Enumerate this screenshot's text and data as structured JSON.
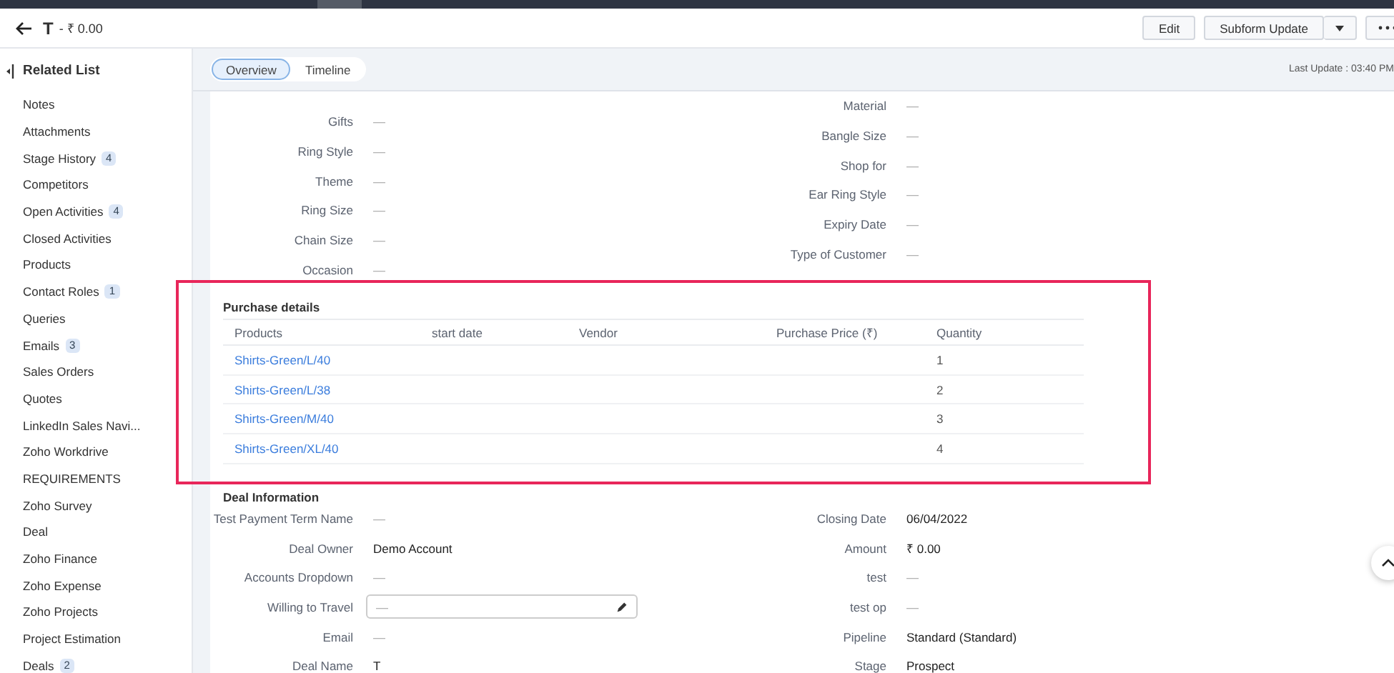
{
  "header": {
    "title": "T",
    "amount": "- ₹ 0.00",
    "buttons": [
      {
        "label": "Edit",
        "kind": "plain"
      },
      {
        "label": "Subform Update",
        "kind": "split"
      }
    ]
  },
  "tabs": [
    {
      "label": "Overview",
      "selected": true
    },
    {
      "label": "Timeline",
      "selected": false
    }
  ],
  "last_update": "Last Update : 03:40 PM",
  "sidebar": {
    "title": "Related List",
    "items": [
      {
        "label": "Notes"
      },
      {
        "label": "Attachments"
      },
      {
        "label": "Stage History",
        "count": "4"
      },
      {
        "label": "Competitors"
      },
      {
        "label": "Open Activities",
        "count": "4"
      },
      {
        "label": "Closed Activities"
      },
      {
        "label": "Products"
      },
      {
        "label": "Contact Roles",
        "count": "1"
      },
      {
        "label": "Queries"
      },
      {
        "label": "Emails",
        "count": "3"
      },
      {
        "label": "Sales Orders"
      },
      {
        "label": "Quotes"
      },
      {
        "label": "LinkedIn Sales Navi..."
      },
      {
        "label": "Zoho Workdrive"
      },
      {
        "label": "REQUIREMENTS"
      },
      {
        "label": "Zoho Survey"
      },
      {
        "label": "Deal"
      },
      {
        "label": "Zoho Finance"
      },
      {
        "label": "Zoho Expense"
      },
      {
        "label": "Zoho Projects"
      },
      {
        "label": "Project Estimation"
      },
      {
        "label": "Deals",
        "count": "2"
      }
    ]
  },
  "details": {
    "left": [
      {
        "label": "Gifts",
        "value": "—"
      },
      {
        "label": "Ring Style",
        "value": "—"
      },
      {
        "label": "Theme",
        "value": "—"
      },
      {
        "label": "Ring Size",
        "value": "—"
      },
      {
        "label": "Chain Size",
        "value": "—"
      },
      {
        "label": "Occasion",
        "value": "—"
      }
    ],
    "right": [
      {
        "label": "Material",
        "value": "—"
      },
      {
        "label": "Bangle Size",
        "value": "—"
      },
      {
        "label": "Shop for",
        "value": "—"
      },
      {
        "label": "Ear Ring Style",
        "value": "—"
      },
      {
        "label": "Expiry Date",
        "value": "—"
      },
      {
        "label": "Type of Customer",
        "value": "—"
      }
    ]
  },
  "purchase_details": {
    "title": "Purchase details",
    "columns": [
      "Products",
      "start date",
      "Vendor",
      "Purchase Price (₹)",
      "Quantity"
    ],
    "rows": [
      {
        "cells": [
          "Shirts-Green/L/40",
          "",
          "",
          "",
          "1"
        ]
      },
      {
        "cells": [
          "Shirts-Green/L/38",
          "",
          "",
          "",
          "2"
        ]
      },
      {
        "cells": [
          "Shirts-Green/M/40",
          "",
          "",
          "",
          "3"
        ]
      },
      {
        "cells": [
          "Shirts-Green/XL/40",
          "",
          "",
          "",
          "4"
        ]
      }
    ]
  },
  "deal_information": {
    "title": "Deal Information",
    "left": [
      {
        "label": "Test Payment Term Name",
        "value": "—",
        "kind": "text"
      },
      {
        "label": "Deal Owner",
        "value": "Demo Account",
        "kind": "text"
      },
      {
        "label": "Accounts Dropdown",
        "value": "—",
        "kind": "text"
      },
      {
        "label": "Willing to Travel",
        "value": "—",
        "kind": "editable"
      },
      {
        "label": "Email",
        "value": "—",
        "kind": "text"
      },
      {
        "label": "Deal Name",
        "value": "T",
        "kind": "text"
      }
    ],
    "right": [
      {
        "label": "Closing Date",
        "value": "06/04/2022"
      },
      {
        "label": "Amount",
        "value": "₹ 0.00"
      },
      {
        "label": "test",
        "value": "—"
      },
      {
        "label": "test op",
        "value": "—"
      },
      {
        "label": "Pipeline",
        "value": "Standard (Standard)"
      },
      {
        "label": "Stage",
        "value": "Prospect"
      }
    ]
  }
}
